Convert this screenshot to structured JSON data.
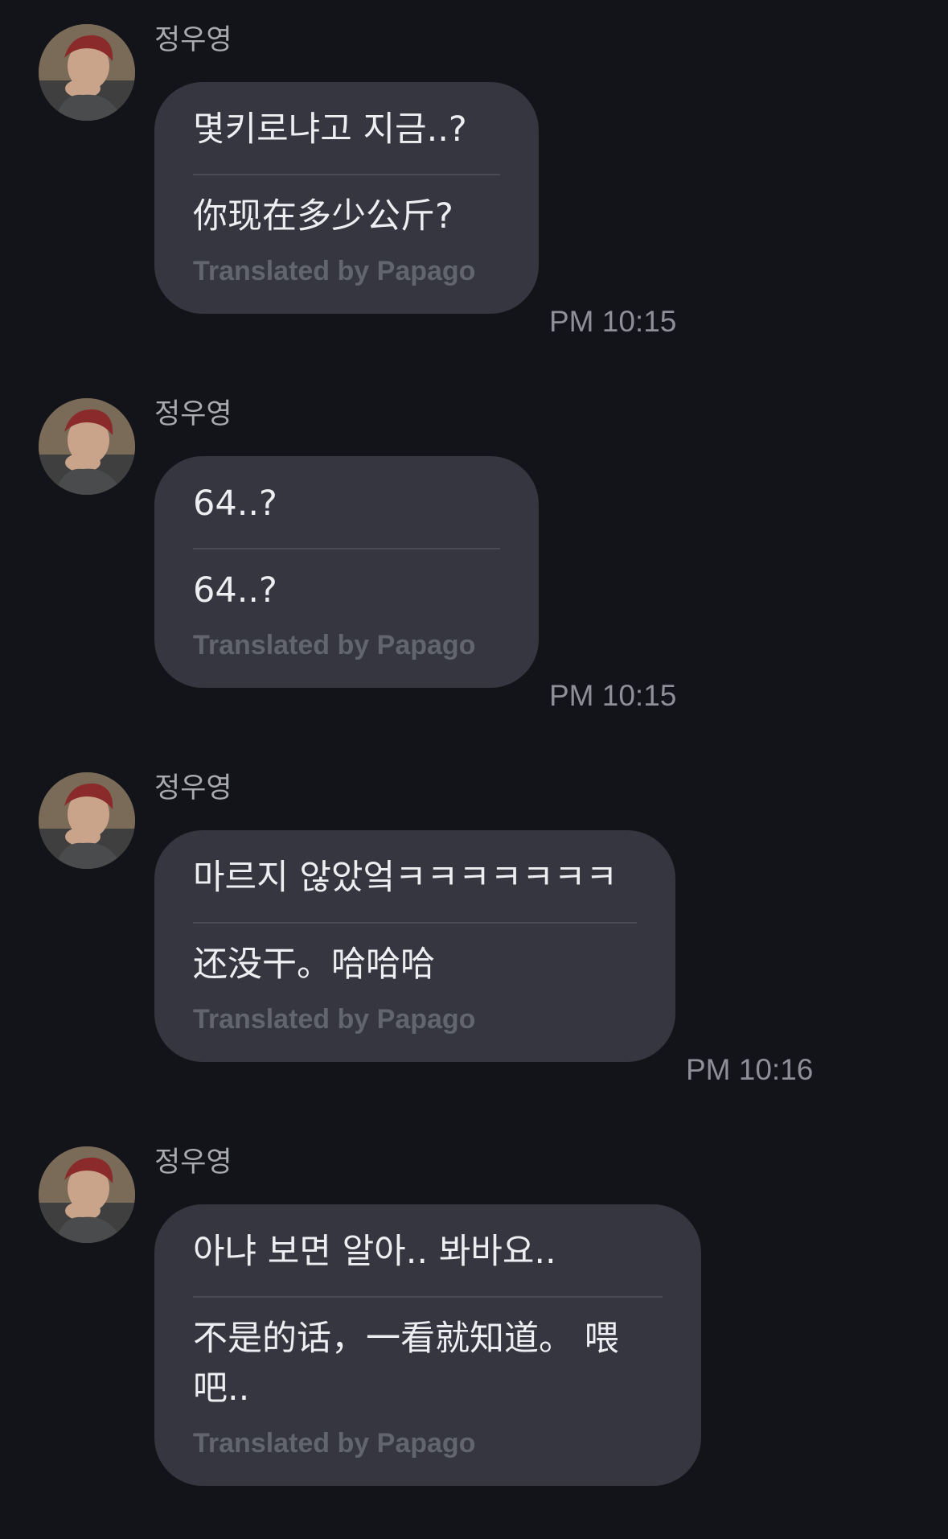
{
  "messages": [
    {
      "sender": "정우영",
      "original": "몇키로냐고 지금..?",
      "translated": "你现在多少公斤?",
      "credit": "Translated by Papago",
      "time": "PM 10:15"
    },
    {
      "sender": "정우영",
      "original": "64..?",
      "translated": "64..?",
      "credit": "Translated by Papago",
      "time": "PM 10:15"
    },
    {
      "sender": "정우영",
      "original": "마르지 않았엌ㅋㅋㅋㅋㅋㅋㅋ",
      "translated": "还没干。哈哈哈",
      "credit": "Translated by Papago",
      "time": "PM 10:16"
    },
    {
      "sender": "정우영",
      "original": "아냐 보면 알아.. 봐바요..",
      "translated": "不是的话，一看就知道。 喂吧..",
      "credit": "Translated by Papago",
      "time": ""
    }
  ]
}
